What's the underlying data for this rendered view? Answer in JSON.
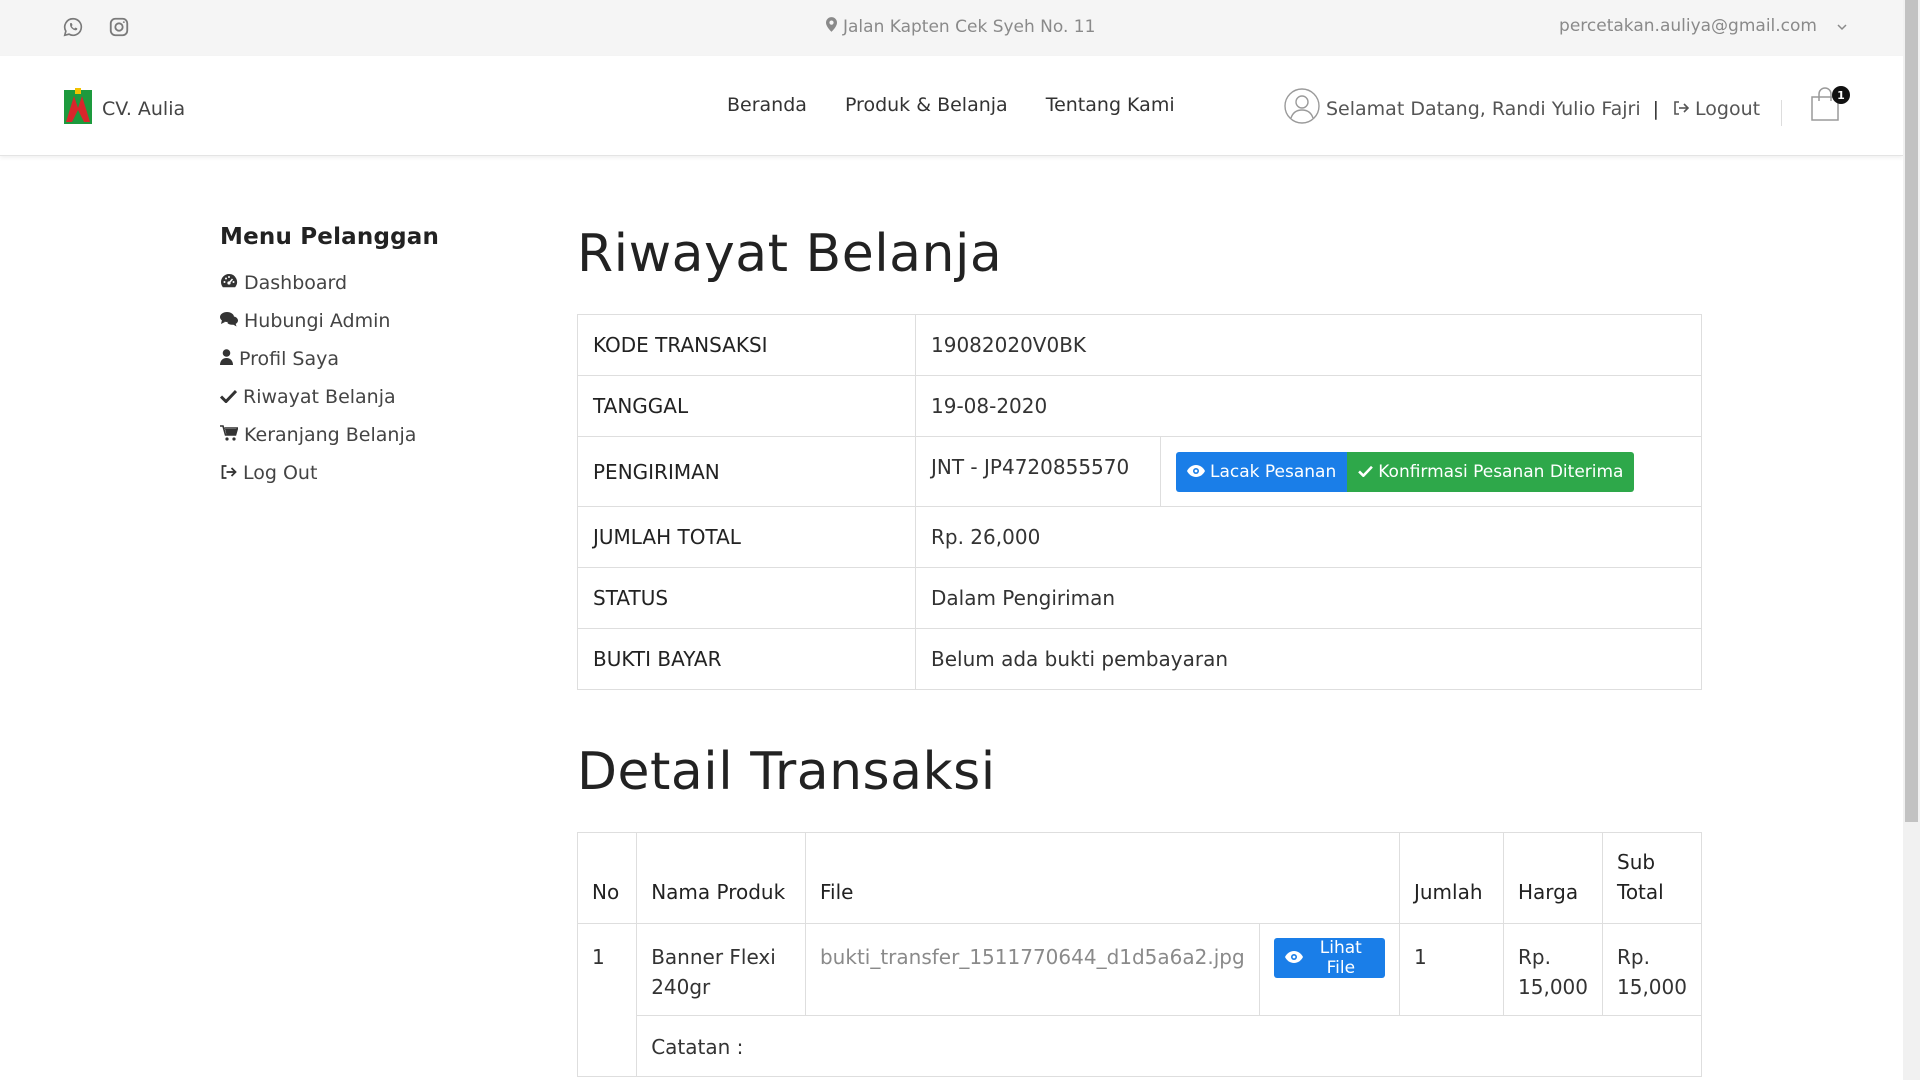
{
  "topbar": {
    "address": "Jalan Kapten Cek Syeh No. 11",
    "email": "percetakan.auliya@gmail.com"
  },
  "header": {
    "brand": "CV. Aulia",
    "nav": [
      "Beranda",
      "Produk & Belanja",
      "Tentang Kami"
    ],
    "welcome": "Selamat Datang, Randi Yulio Fajri",
    "separator": "|",
    "logout": "Logout",
    "cart_count": "1"
  },
  "sidebar": {
    "title": "Menu Pelanggan",
    "items": [
      {
        "label": "Dashboard",
        "icon": "dashboard-icon"
      },
      {
        "label": "Hubungi Admin",
        "icon": "comments-icon"
      },
      {
        "label": "Profil Saya",
        "icon": "user-icon"
      },
      {
        "label": "Riwayat Belanja",
        "icon": "check-icon"
      },
      {
        "label": "Keranjang Belanja",
        "icon": "cart-icon"
      },
      {
        "label": "Log Out",
        "icon": "sign-out-icon"
      }
    ]
  },
  "history": {
    "title": "Riwayat Belanja",
    "rows": {
      "kode": {
        "label": "KODE TRANSAKSI",
        "value": "19082020V0BK"
      },
      "tanggal": {
        "label": "TANGGAL",
        "value": "19-08-2020"
      },
      "pengiriman": {
        "label": "PENGIRIMAN",
        "value": "JNT - JP4720855570"
      },
      "total": {
        "label": "JUMLAH TOTAL",
        "value": "Rp. 26,000"
      },
      "status": {
        "label": "STATUS",
        "value": "Dalam Pengiriman"
      },
      "bukti": {
        "label": "BUKTI BAYAR",
        "value": "Belum ada bukti pembayaran"
      }
    },
    "track_button": "Lacak Pesanan",
    "confirm_button": "Konfirmasi Pesanan Diterima"
  },
  "detail": {
    "title": "Detail Transaksi",
    "headers": {
      "no": "No",
      "product": "Nama Produk",
      "file": "File",
      "qty": "Jumlah",
      "price": "Harga",
      "subtotal_1": "Sub",
      "subtotal_2": "Total"
    },
    "item": {
      "no": "1",
      "product_1": "Banner Flexi",
      "product_2": "240gr",
      "file": "bukti_transfer_1511770644_d1d5a6a2.jpg",
      "view_button": "Lihat File",
      "qty": "1",
      "price_1": "Rp.",
      "price_2": "15,000",
      "subtotal_1": "Rp.",
      "subtotal_2": "15,000",
      "note": "Catatan :"
    }
  },
  "colors": {
    "primary_blue": "#1a7ee8",
    "success_green": "#2ea84a",
    "topbar_bg": "#f5f5f5"
  }
}
